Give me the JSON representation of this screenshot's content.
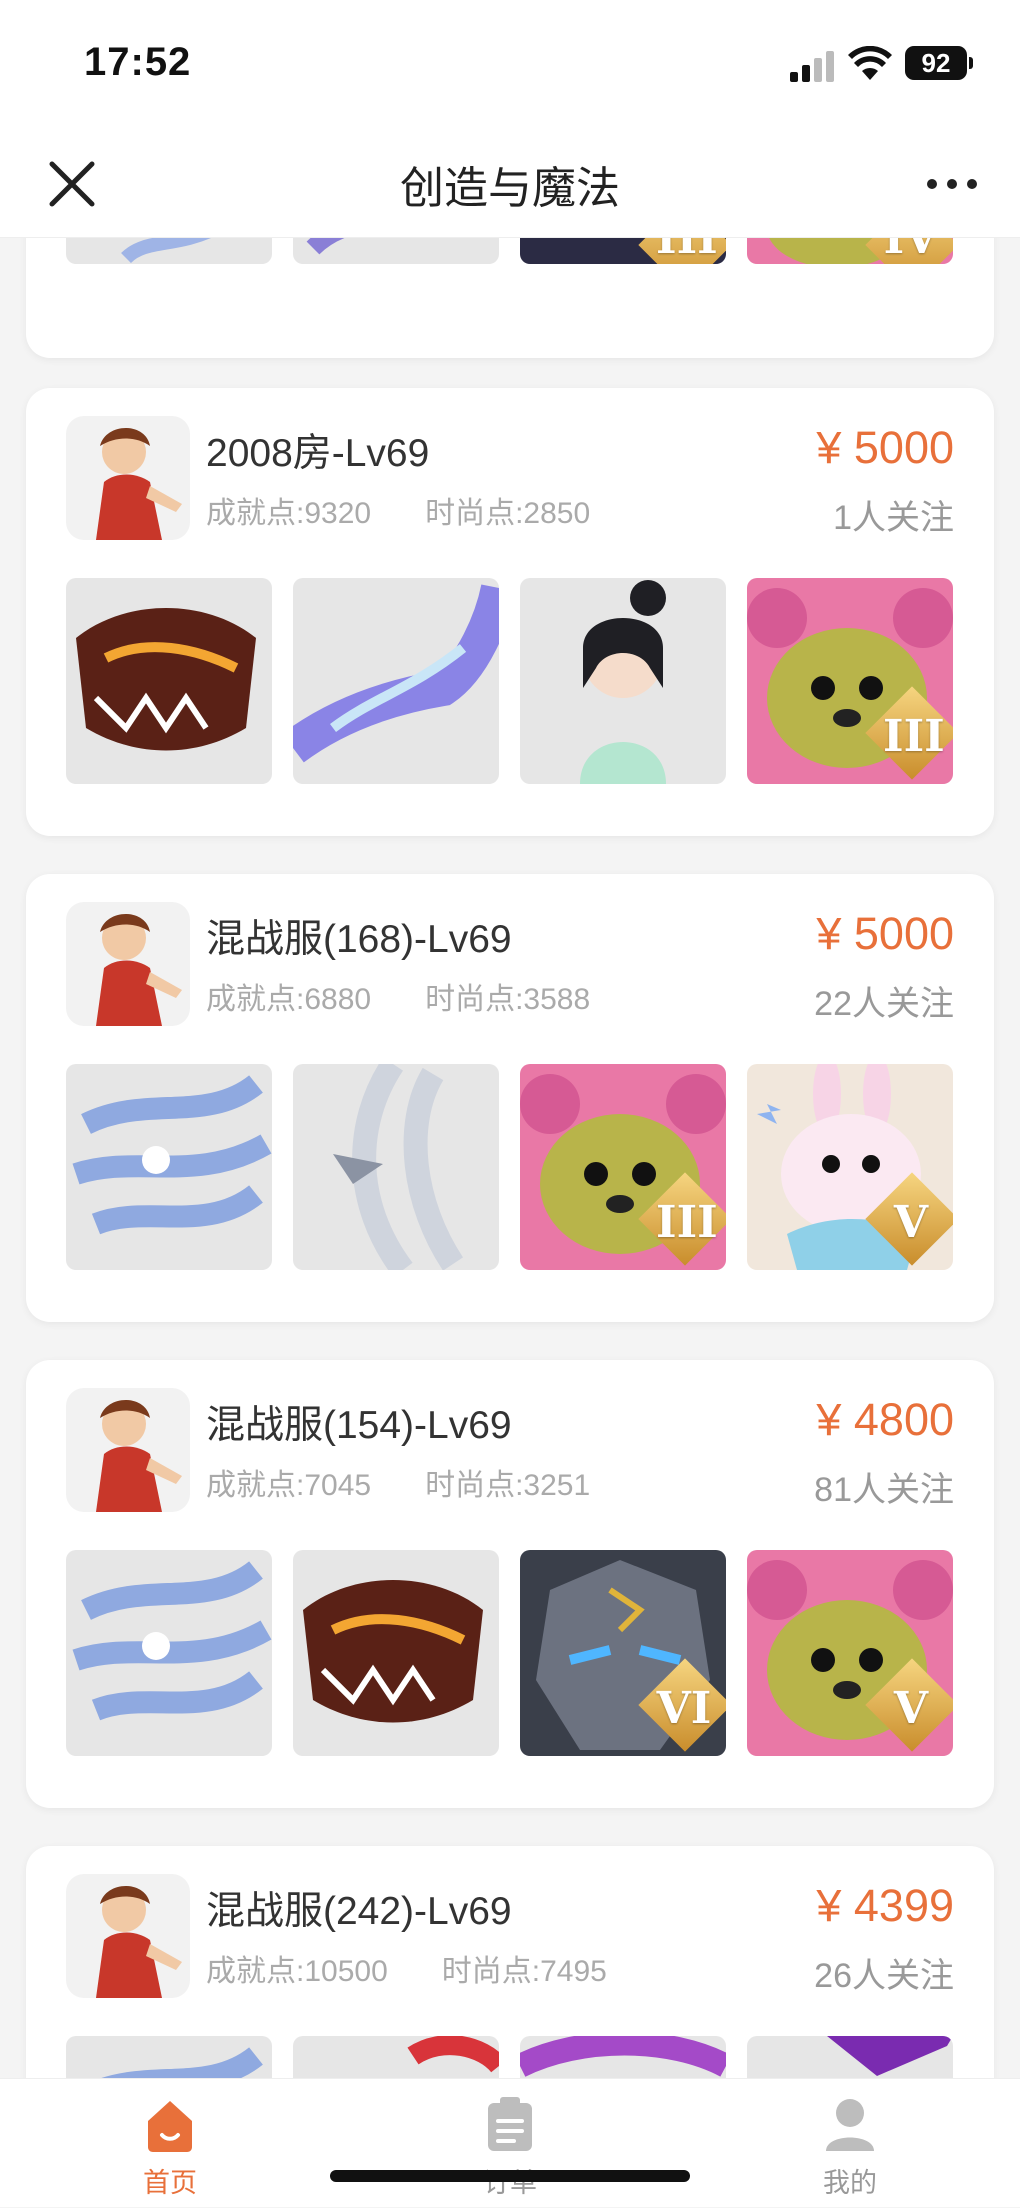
{
  "status_bar": {
    "time": "17:52",
    "battery": "92"
  },
  "nav": {
    "title": "创造与魔法"
  },
  "listings": [
    {
      "name": "",
      "achievement": "",
      "fashion": "",
      "price": "",
      "followers": "",
      "badges": [
        "",
        "",
        "III",
        "IV"
      ]
    },
    {
      "name": "2008房-Lv69",
      "achievement": "成就点:9320",
      "fashion": "时尚点:2850",
      "price": "¥ 5000",
      "followers": "1人关注",
      "badges": [
        "",
        "",
        "",
        "III"
      ]
    },
    {
      "name": "混战服(168)-Lv69",
      "achievement": "成就点:6880",
      "fashion": "时尚点:3588",
      "price": "¥ 5000",
      "followers": "22人关注",
      "badges": [
        "",
        "",
        "III",
        "V"
      ]
    },
    {
      "name": "混战服(154)-Lv69",
      "achievement": "成就点:7045",
      "fashion": "时尚点:3251",
      "price": "¥ 4800",
      "followers": "81人关注",
      "badges": [
        "",
        "",
        "VI",
        "V"
      ]
    },
    {
      "name": "混战服(242)-Lv69",
      "achievement": "成就点:10500",
      "fashion": "时尚点:7495",
      "price": "¥ 4399",
      "followers": "26人关注",
      "badges": [
        "",
        "",
        "",
        ""
      ]
    }
  ],
  "tabbar": {
    "home": "首页",
    "orders": "订单",
    "mine": "我的"
  },
  "colors": {
    "accent": "#e8703a",
    "card_bg": "#ffffff",
    "page_bg": "#f4f4f4"
  },
  "icons": {
    "close": "close-icon",
    "more": "more-icon",
    "home": "home-icon",
    "orders": "orders-icon",
    "mine": "user-icon"
  }
}
